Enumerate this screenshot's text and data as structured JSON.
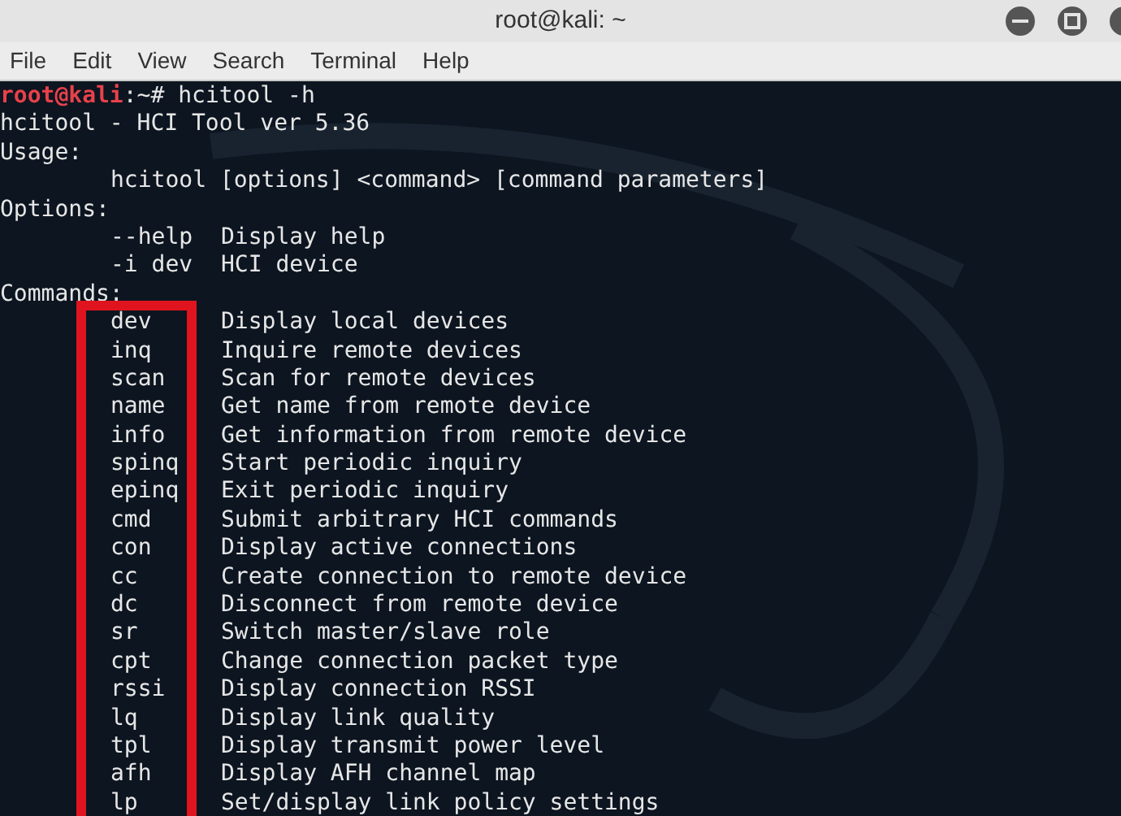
{
  "window": {
    "title": "root@kali: ~"
  },
  "menu": [
    "File",
    "Edit",
    "View",
    "Search",
    "Terminal",
    "Help"
  ],
  "terminal": {
    "prompt": {
      "user_host": "root@kali",
      "separator": ":~#",
      "command": "hcitool -h"
    },
    "header_lines": [
      "hcitool - HCI Tool ver 5.36",
      "Usage:"
    ],
    "usage_line": "hcitool [options] <command> [command parameters]",
    "options_heading": "Options:",
    "options": [
      {
        "flag": "--help",
        "description": "Display help"
      },
      {
        "flag": "-i dev",
        "description": "HCI device"
      }
    ],
    "commands_heading": "Commands:",
    "commands": [
      {
        "name": "dev",
        "description": "Display local devices"
      },
      {
        "name": "inq",
        "description": "Inquire remote devices"
      },
      {
        "name": "scan",
        "description": "Scan for remote devices"
      },
      {
        "name": "name",
        "description": "Get name from remote device"
      },
      {
        "name": "info",
        "description": "Get information from remote device"
      },
      {
        "name": "spinq",
        "description": "Start periodic inquiry"
      },
      {
        "name": "epinq",
        "description": "Exit periodic inquiry"
      },
      {
        "name": "cmd",
        "description": "Submit arbitrary HCI commands"
      },
      {
        "name": "con",
        "description": "Display active connections"
      },
      {
        "name": "cc",
        "description": "Create connection to remote device"
      },
      {
        "name": "dc",
        "description": "Disconnect from remote device"
      },
      {
        "name": "sr",
        "description": "Switch master/slave role"
      },
      {
        "name": "cpt",
        "description": "Change connection packet type"
      },
      {
        "name": "rssi",
        "description": "Display connection RSSI"
      },
      {
        "name": "lq",
        "description": "Display link quality"
      },
      {
        "name": "tpl",
        "description": "Display transmit power level"
      },
      {
        "name": "afh",
        "description": "Display AFH channel map"
      },
      {
        "name": "lp",
        "description": "Set/display link policy settings"
      }
    ]
  }
}
